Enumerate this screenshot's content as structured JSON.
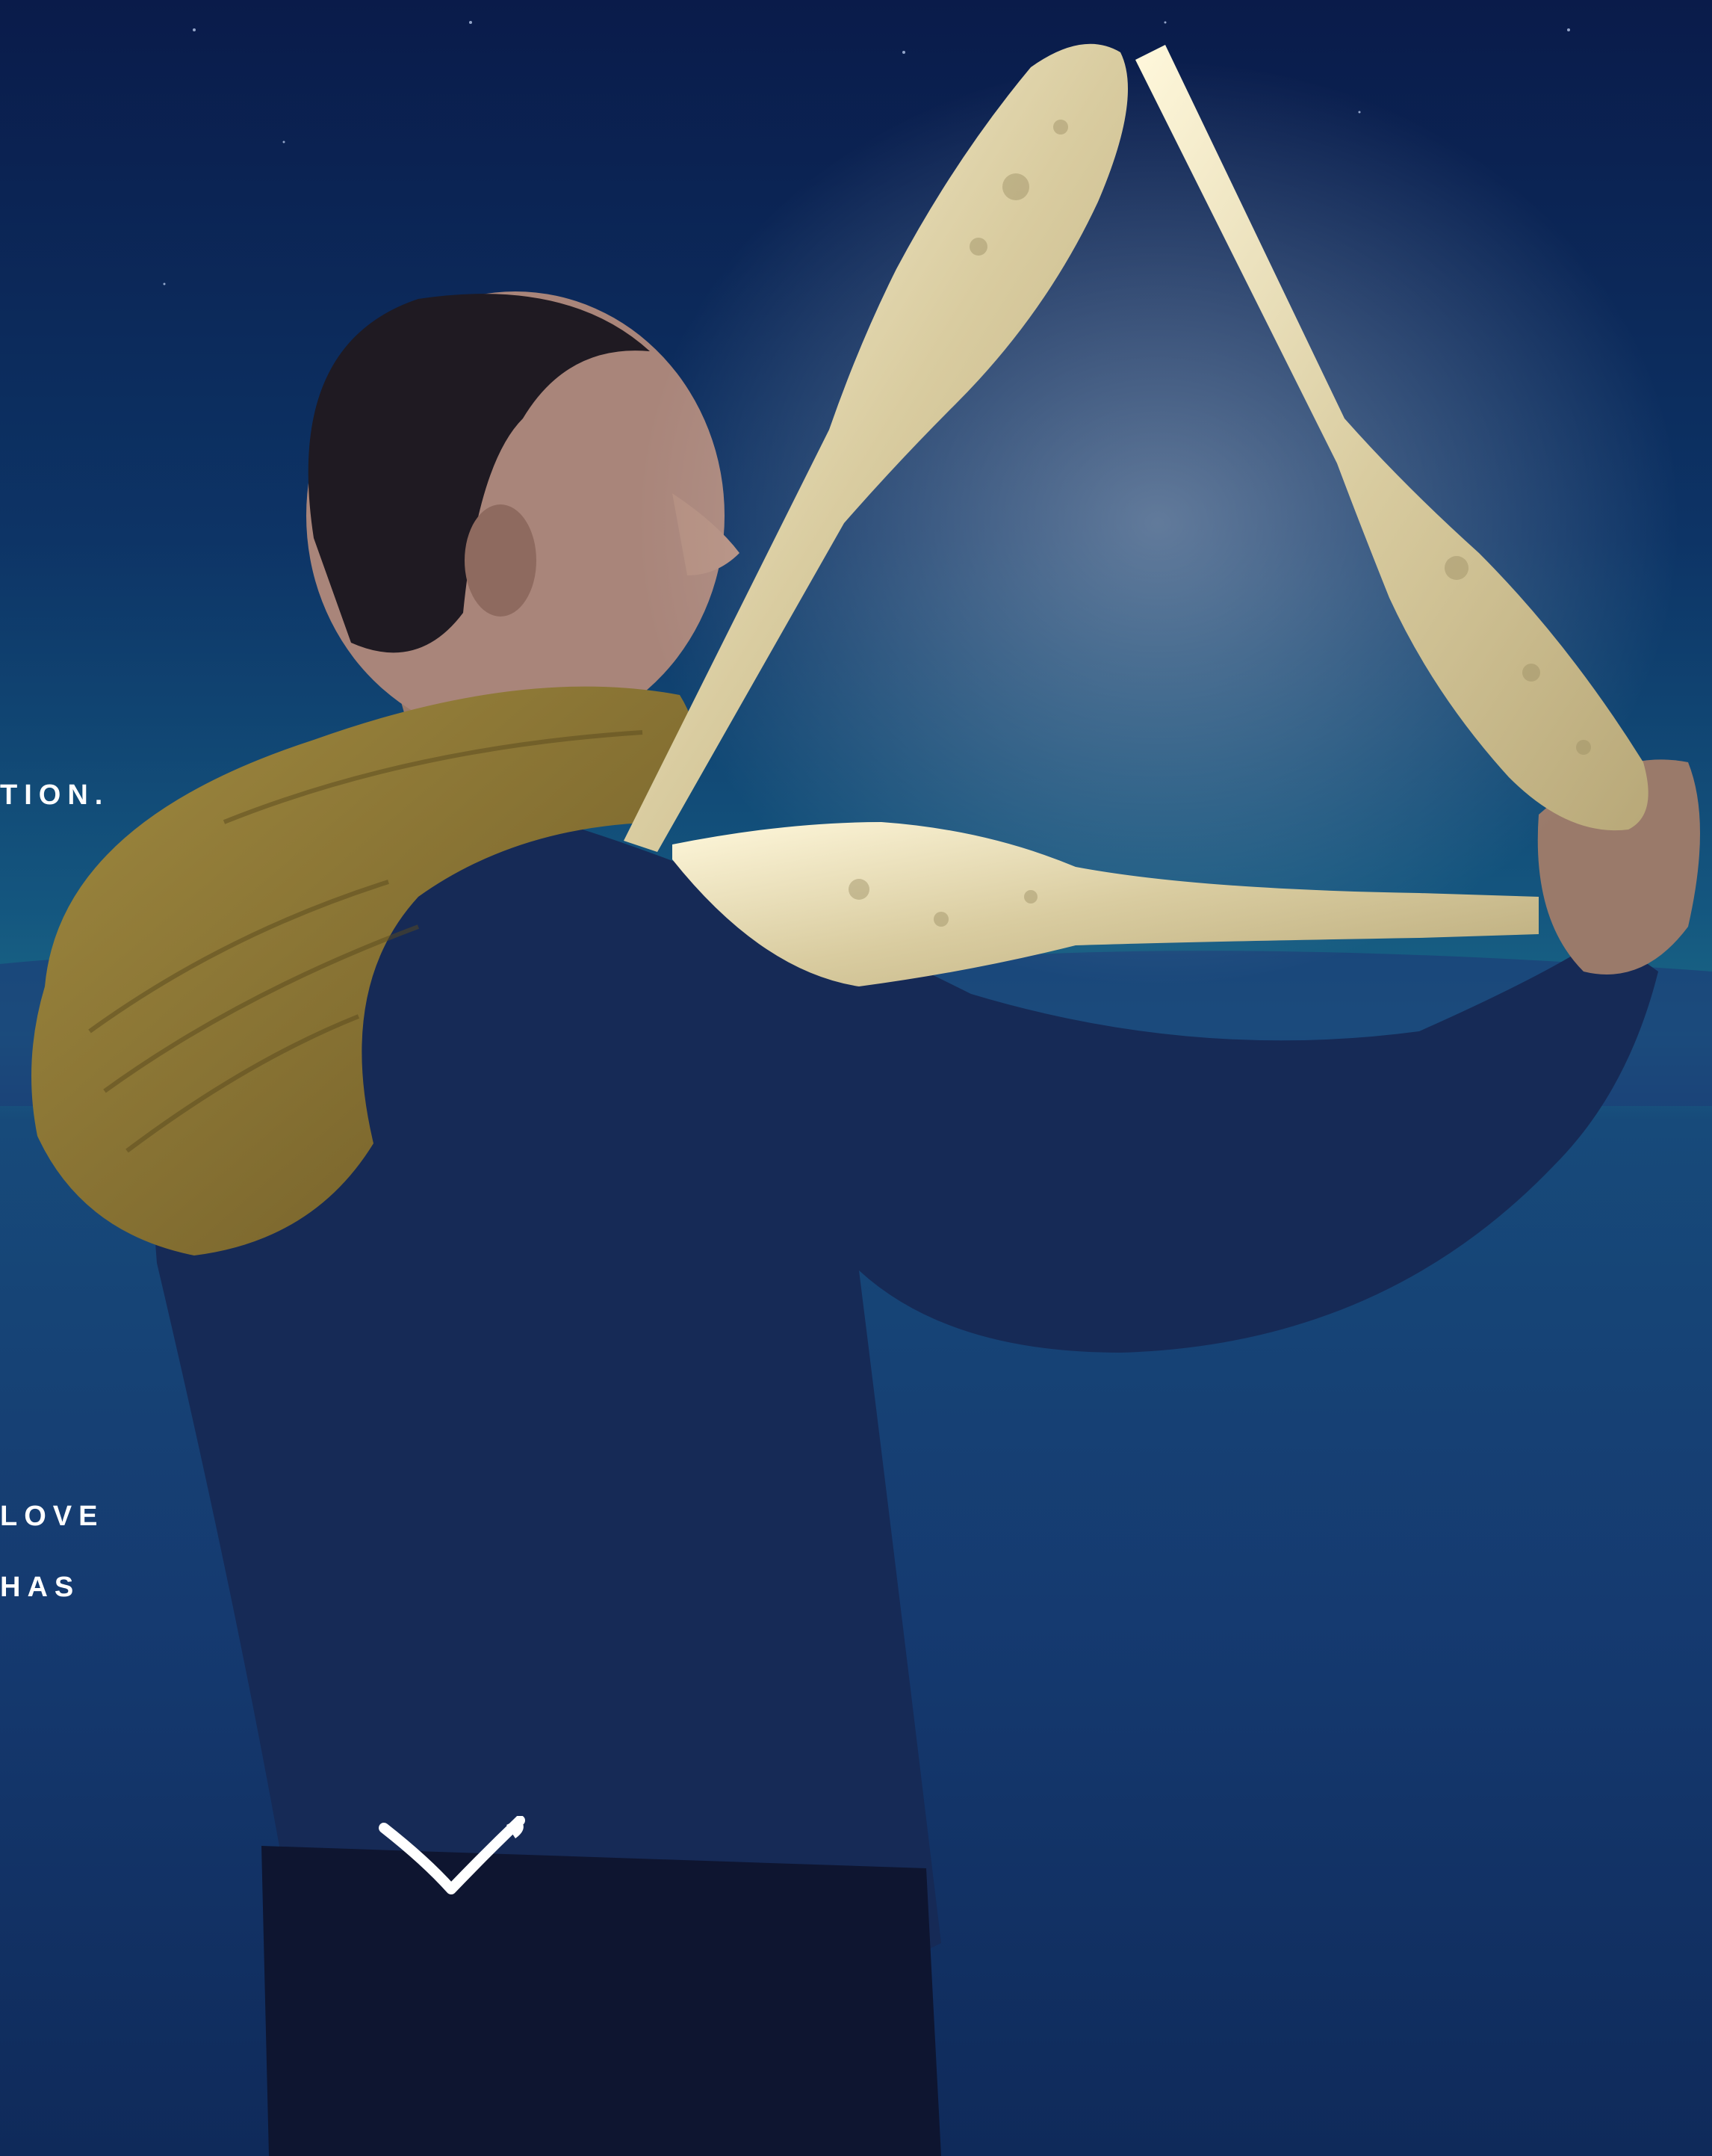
{
  "hero": {
    "background_colors": {
      "sky_top": "#0b1d4d",
      "sky_mid": "#0f4f78",
      "horizon": "#1d6d86",
      "sea": "#173c73",
      "sea_bottom": "#102b5a",
      "moon_glow": "#e8dcae",
      "scarf": "#8a7433",
      "sweater": "#162a56"
    },
    "captions": [
      "TION.",
      "LOVE",
      "HAS"
    ],
    "scroll_icon": "chevron-down-icon"
  }
}
